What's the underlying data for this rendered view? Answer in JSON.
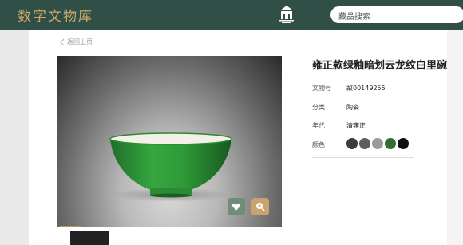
{
  "header": {
    "logo_text": "数字文物库",
    "emblem_icon": "museum-gate-icon",
    "search_placeholder": "藏品搜索"
  },
  "nav": {
    "back_label": "返回上页"
  },
  "artifact": {
    "title": "雍正款绿釉暗划云龙纹白里碗",
    "fields": [
      {
        "label": "文物号",
        "value": "故00149255"
      },
      {
        "label": "分类",
        "value": "陶瓷"
      },
      {
        "label": "年代",
        "value": "清雍正"
      },
      {
        "label": "颜色",
        "value": ""
      }
    ],
    "colors": [
      "#3c3c3c",
      "#5e5e5e",
      "#9a9a9a",
      "#2f6e34",
      "#111111"
    ]
  },
  "actions": {
    "favorite_icon": "heart-icon",
    "zoom_icon": "zoom-in-icon"
  },
  "theme": {
    "header_bg": "#2f4f47",
    "logo_color": "#c9a86a",
    "accent": "#c98d4f"
  }
}
